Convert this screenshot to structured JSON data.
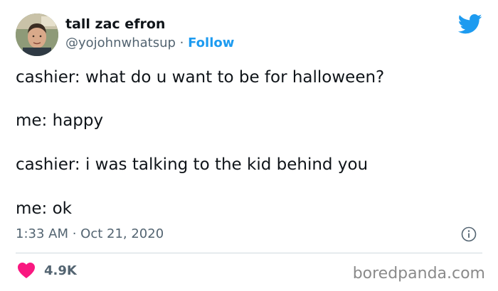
{
  "author": {
    "name": "tall zac efron",
    "handle": "@yojohnwhatsup",
    "separator": " · ",
    "follow_label": "Follow"
  },
  "tweet": {
    "lines": [
      "cashier: what do u want to be for halloween?",
      "me: happy",
      "cashier: i was talking to the kid behind you",
      "me: ok"
    ],
    "timestamp": "1:33 AM · Oct 21, 2020",
    "likes": "4.9K"
  },
  "icons": {
    "brand": "twitter-bird-icon",
    "info": "info-icon",
    "like": "heart-icon"
  },
  "colors": {
    "accent": "#1d9bf0",
    "heart": "#f91880",
    "text": "#0f1419",
    "muted": "#536471"
  },
  "watermark": "boredpanda.com"
}
